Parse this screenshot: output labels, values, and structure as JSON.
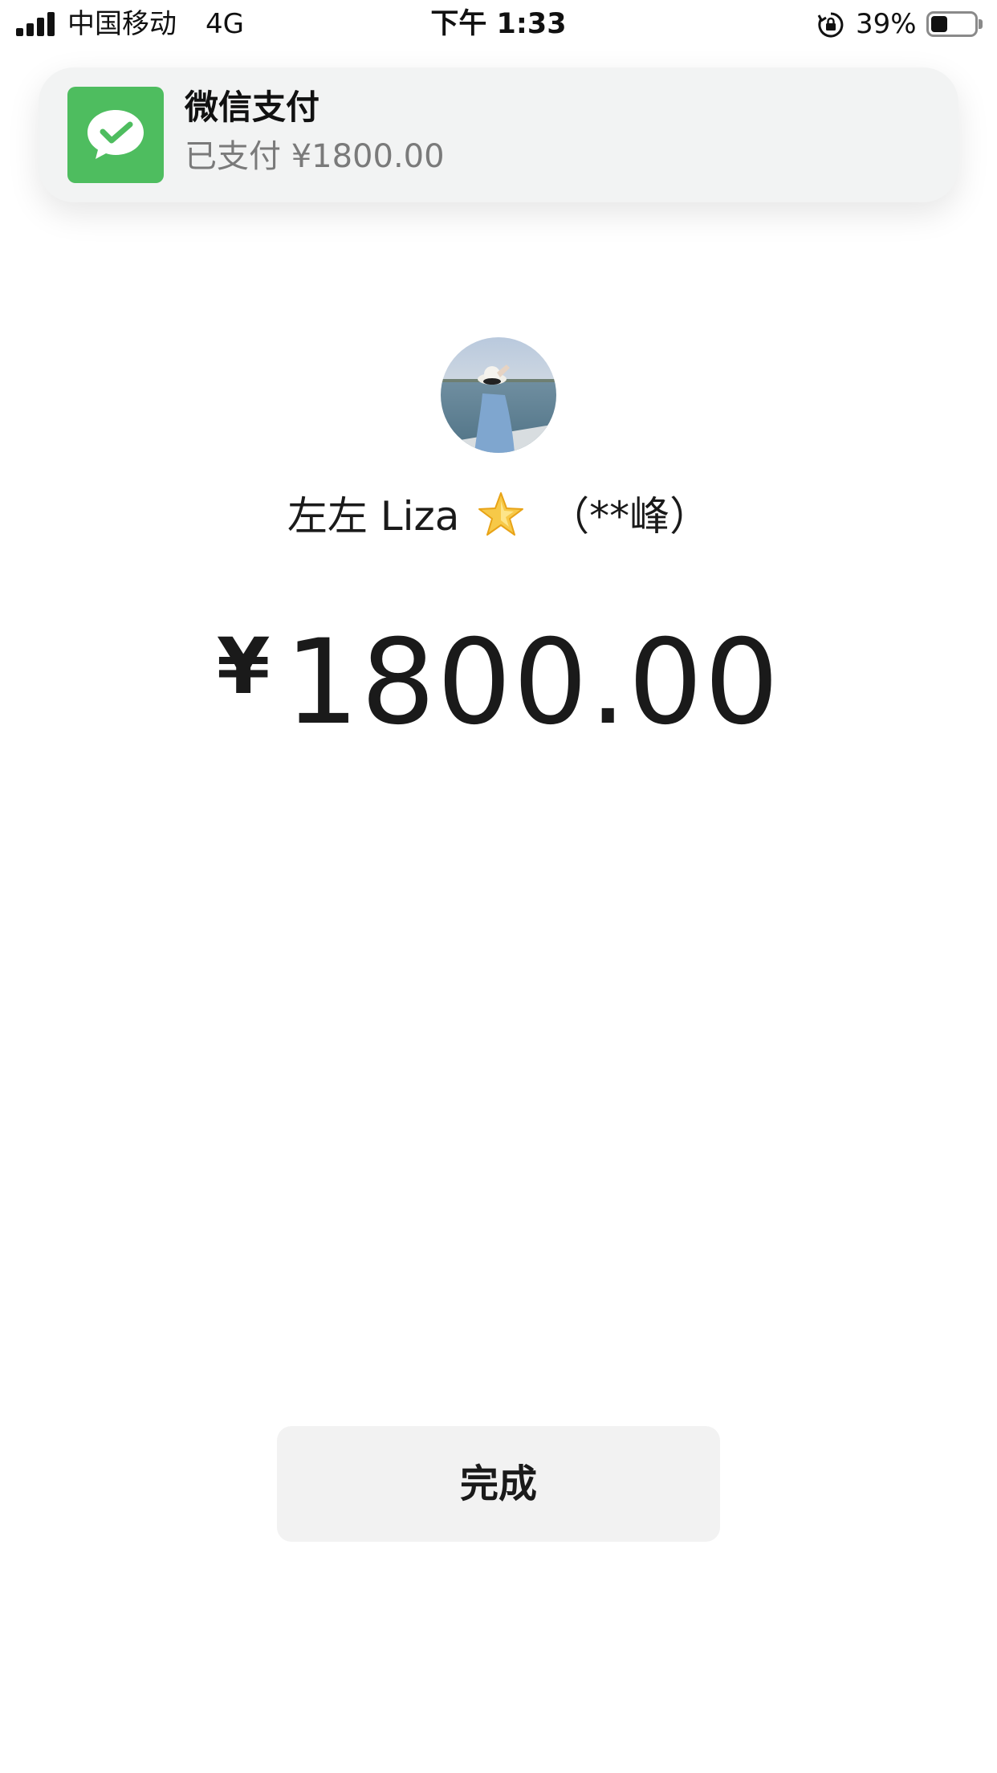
{
  "status_bar": {
    "carrier": "中国移动",
    "network": "4G",
    "time": "下午 1:33",
    "battery_percent": "39%",
    "battery_level": 0.39,
    "icons": [
      "signal-bars-icon",
      "orientation-lock-icon",
      "battery-icon"
    ]
  },
  "notification": {
    "app_name": "微信支付",
    "message": "已支付 ¥1800.00",
    "icon": "wechat-pay-icon",
    "accent_color": "#4ebd5f"
  },
  "payee": {
    "nickname": "左左 Liza",
    "emoji": "star-icon",
    "real_name_masked": "（**峰）",
    "avatar": "avatar"
  },
  "payment": {
    "currency_symbol": "¥",
    "amount": "1800.00"
  },
  "actions": {
    "done_label": "完成"
  },
  "colors": {
    "text": "#1a1a1a",
    "muted": "#7a7a7a",
    "button_bg": "#f2f2f2",
    "banner_bg": "#f2f3f3"
  }
}
